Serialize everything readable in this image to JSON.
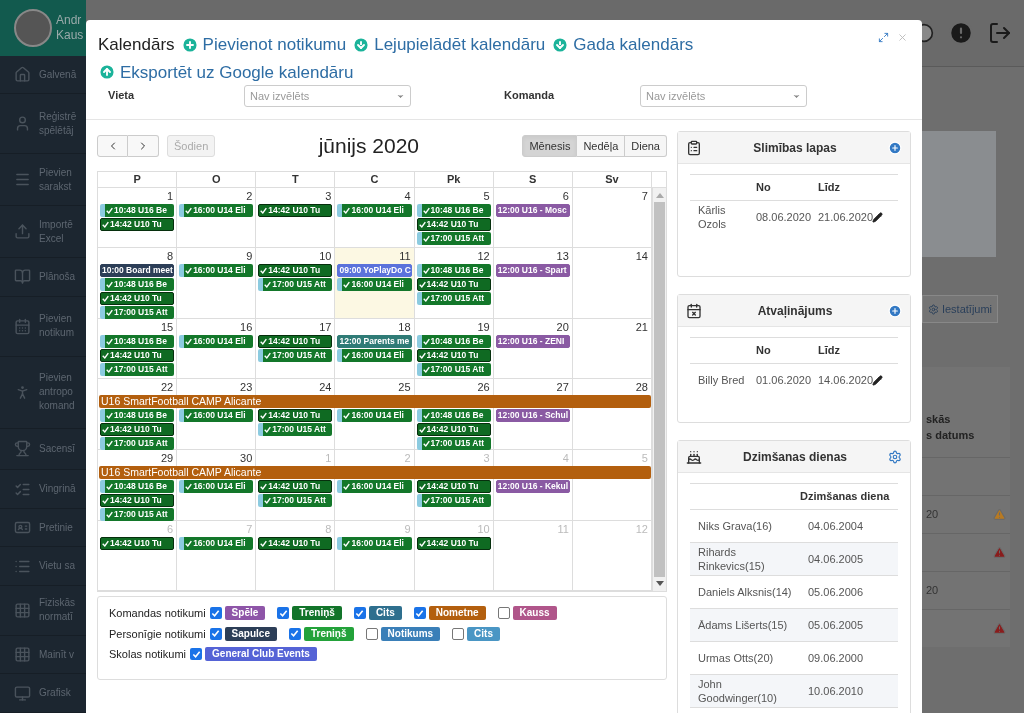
{
  "user": {
    "name_lines": [
      "Andr",
      "Kaus"
    ]
  },
  "sidebar": {
    "items": [
      {
        "lines": [
          "Galvenā"
        ]
      },
      {
        "lines": [
          "Reģistrē",
          "spēlētāj"
        ]
      },
      {
        "lines": [
          "Pievien",
          "sarakst"
        ]
      },
      {
        "lines": [
          "Importē",
          "Excel"
        ]
      },
      {
        "lines": [
          "Plānoša"
        ]
      },
      {
        "lines": [
          "Pievien",
          "notikum"
        ]
      },
      {
        "lines": [
          "Pievien",
          "antropo",
          "komand"
        ]
      },
      {
        "lines": [
          "Sacensī"
        ]
      },
      {
        "lines": [
          "Vingrinā"
        ]
      },
      {
        "lines": [
          "Pretinie"
        ]
      },
      {
        "lines": [
          "Vietu sa"
        ]
      },
      {
        "lines": [
          "Fiziskās",
          "normatī"
        ]
      },
      {
        "lines": [
          "Mainīt v"
        ]
      },
      {
        "lines": [
          "Grafisk"
        ]
      }
    ]
  },
  "background": {
    "settings_button": "Iestatījumi",
    "table_header": [
      "skās",
      "s datums"
    ],
    "rows": [
      {
        "text": "20",
        "color": "#b87a22"
      },
      {
        "color": "#8a1c1c"
      },
      {
        "text": "20"
      },
      {
        "color": "#8a1c1c"
      }
    ]
  },
  "modal": {
    "title": "Kalendārs",
    "links": [
      {
        "label": "Pievienot notikumu"
      },
      {
        "label": "Lejupielādēt kalendāru"
      },
      {
        "label": "Gada kalendārs"
      },
      {
        "label": "Eksportēt uz Google kalendāru"
      }
    ],
    "filters": [
      {
        "label": "Vieta",
        "placeholder": "Nav izvēlēts"
      },
      {
        "label": "Komanda",
        "placeholder": "Nav izvēlēts"
      }
    ]
  },
  "calendar": {
    "title": "jūnijs 2020",
    "today_button": {
      "label": "Šodien",
      "disabled": true
    },
    "views": [
      {
        "label": "Mēnesis",
        "selected": true
      },
      {
        "label": "Nedēļa",
        "selected": false
      },
      {
        "label": "Diena",
        "selected": false
      }
    ],
    "weekdays": [
      "P",
      "O",
      "T",
      "C",
      "Pk",
      "S",
      "Sv"
    ],
    "weeks": [
      {
        "days": [
          {
            "date": "1",
            "other_month": false,
            "today": false,
            "events": [
              {
                "text": "10:48 U16 Be",
                "color": "#13772a",
                "done": true,
                "stripe": true
              },
              {
                "text": "14:42 U10 Tu",
                "color": "#0f6a22",
                "done": true,
                "stripe": false
              }
            ]
          },
          {
            "date": "2",
            "other_month": false,
            "today": false,
            "events": [
              {
                "text": "16:00 U14 Eli",
                "color": "#13772a",
                "done": true,
                "stripe": true
              }
            ]
          },
          {
            "date": "3",
            "other_month": false,
            "today": false,
            "events": [
              {
                "text": "14:42 U10 Tu",
                "color": "#0f6a22",
                "done": true,
                "stripe": false
              }
            ]
          },
          {
            "date": "4",
            "other_month": false,
            "today": false,
            "events": [
              {
                "text": "16:00 U14 Eli",
                "color": "#13772a",
                "done": true,
                "stripe": true
              }
            ]
          },
          {
            "date": "5",
            "other_month": false,
            "today": false,
            "events": [
              {
                "text": "10:48 U16 Be",
                "color": "#13772a",
                "done": true,
                "stripe": true
              },
              {
                "text": "14:42 U10 Tu",
                "color": "#0f6a22",
                "done": true,
                "stripe": false
              },
              {
                "text": "17:00 U15 Att",
                "color": "#13772a",
                "done": true,
                "stripe": true
              }
            ]
          },
          {
            "date": "6",
            "other_month": false,
            "today": false,
            "events": [
              {
                "text": "12:00 U16 - Mosc",
                "color": "#8a5aa3",
                "done": false,
                "stripe": false
              }
            ]
          },
          {
            "date": "7",
            "other_month": false,
            "today": false
          }
        ]
      },
      {
        "days": [
          {
            "date": "8",
            "other_month": false,
            "today": false,
            "events": [
              {
                "text": "10:00 Board meet",
                "color": "#2c3e57",
                "done": false,
                "stripe": false
              },
              {
                "text": "10:48 U16 Be",
                "color": "#13772a",
                "done": true,
                "stripe": true
              },
              {
                "text": "14:42 U10 Tu",
                "color": "#0f6a22",
                "done": true,
                "stripe": false
              },
              {
                "text": "17:00 U15 Att",
                "color": "#13772a",
                "done": true,
                "stripe": true
              }
            ]
          },
          {
            "date": "9",
            "other_month": false,
            "today": false,
            "events": [
              {
                "text": "16:00 U14 Eli",
                "color": "#13772a",
                "done": true,
                "stripe": true
              }
            ]
          },
          {
            "date": "10",
            "other_month": false,
            "today": false,
            "events": [
              {
                "text": "14:42 U10 Tu",
                "color": "#0f6a22",
                "done": true,
                "stripe": false
              },
              {
                "text": "17:00 U15 Att",
                "color": "#13772a",
                "done": true,
                "stripe": true
              }
            ]
          },
          {
            "date": "11",
            "other_month": false,
            "today": true,
            "events": [
              {
                "text": "09:00 YoPlayDo C",
                "color": "#5b72db",
                "done": false,
                "stripe": false
              },
              {
                "text": "16:00 U14 Eli",
                "color": "#13772a",
                "done": true,
                "stripe": true
              }
            ]
          },
          {
            "date": "12",
            "other_month": false,
            "today": false,
            "events": [
              {
                "text": "10:48 U16 Be",
                "color": "#13772a",
                "done": true,
                "stripe": true
              },
              {
                "text": "14:42 U10 Tu",
                "color": "#0f6a22",
                "done": true,
                "stripe": false
              },
              {
                "text": "17:00 U15 Att",
                "color": "#13772a",
                "done": true,
                "stripe": true
              }
            ]
          },
          {
            "date": "13",
            "other_month": false,
            "today": false,
            "events": [
              {
                "text": "12:00 U16 - Spart",
                "color": "#8a5aa3",
                "done": false,
                "stripe": false
              }
            ]
          },
          {
            "date": "14",
            "other_month": false,
            "today": false
          }
        ]
      },
      {
        "days": [
          {
            "date": "15",
            "other_month": false,
            "today": false,
            "events": [
              {
                "text": "10:48 U16 Be",
                "color": "#13772a",
                "done": true,
                "stripe": true
              },
              {
                "text": "14:42 U10 Tu",
                "color": "#0f6a22",
                "done": true,
                "stripe": false
              },
              {
                "text": "17:00 U15 Att",
                "color": "#13772a",
                "done": true,
                "stripe": true
              }
            ]
          },
          {
            "date": "16",
            "other_month": false,
            "today": false,
            "events": [
              {
                "text": "16:00 U14 Eli",
                "color": "#13772a",
                "done": true,
                "stripe": true
              }
            ]
          },
          {
            "date": "17",
            "other_month": false,
            "today": false,
            "events": [
              {
                "text": "14:42 U10 Tu",
                "color": "#0f6a22",
                "done": true,
                "stripe": false
              },
              {
                "text": "17:00 U15 Att",
                "color": "#13772a",
                "done": true,
                "stripe": true
              }
            ]
          },
          {
            "date": "18",
            "other_month": false,
            "today": false,
            "events": [
              {
                "text": "12:00 Parents me",
                "color": "#2f7b76",
                "done": false,
                "stripe": false
              },
              {
                "text": "16:00 U14 Eli",
                "color": "#13772a",
                "done": true,
                "stripe": true
              }
            ]
          },
          {
            "date": "19",
            "other_month": false,
            "today": false,
            "events": [
              {
                "text": "10:48 U16 Be",
                "color": "#13772a",
                "done": true,
                "stripe": true
              },
              {
                "text": "14:42 U10 Tu",
                "color": "#0f6a22",
                "done": true,
                "stripe": false
              },
              {
                "text": "17:00 U15 Att",
                "color": "#13772a",
                "done": true,
                "stripe": true
              }
            ]
          },
          {
            "date": "20",
            "other_month": false,
            "today": false,
            "events": [
              {
                "text": "12:00 U16 - ZENI",
                "color": "#8a5aa3",
                "done": false,
                "stripe": false
              }
            ]
          },
          {
            "date": "21",
            "other_month": false,
            "today": false
          }
        ]
      },
      {
        "span": {
          "text": "U16 SmartFootball CAMP Alicante",
          "color": "#b35f0e"
        },
        "days": [
          {
            "date": "22",
            "other_month": false,
            "today": false,
            "events": [
              {
                "text": "10:48 U16 Be",
                "color": "#13772a",
                "done": true,
                "stripe": true
              },
              {
                "text": "14:42 U10 Tu",
                "color": "#0f6a22",
                "done": true,
                "stripe": false
              },
              {
                "text": "17:00 U15 Att",
                "color": "#13772a",
                "done": true,
                "stripe": true
              }
            ]
          },
          {
            "date": "23",
            "other_month": false,
            "today": false,
            "events": [
              {
                "text": "16:00 U14 Eli",
                "color": "#13772a",
                "done": true,
                "stripe": true
              }
            ]
          },
          {
            "date": "24",
            "other_month": false,
            "today": false,
            "events": [
              {
                "text": "14:42 U10 Tu",
                "color": "#0f6a22",
                "done": true,
                "stripe": false
              },
              {
                "text": "17:00 U15 Att",
                "color": "#13772a",
                "done": true,
                "stripe": true
              }
            ]
          },
          {
            "date": "25",
            "other_month": false,
            "today": false,
            "events": [
              {
                "text": "16:00 U14 Eli",
                "color": "#13772a",
                "done": true,
                "stripe": true
              }
            ]
          },
          {
            "date": "26",
            "other_month": false,
            "today": false,
            "events": [
              {
                "text": "10:48 U16 Be",
                "color": "#13772a",
                "done": true,
                "stripe": true
              },
              {
                "text": "14:42 U10 Tu",
                "color": "#0f6a22",
                "done": true,
                "stripe": false
              },
              {
                "text": "17:00 U15 Att",
                "color": "#13772a",
                "done": true,
                "stripe": true
              }
            ]
          },
          {
            "date": "27",
            "other_month": false,
            "today": false,
            "events": [
              {
                "text": "12:00 U16 - Schul",
                "color": "#8a5aa3",
                "done": false,
                "stripe": false
              }
            ]
          },
          {
            "date": "28",
            "other_month": false,
            "today": false
          }
        ]
      },
      {
        "span": {
          "text": "U16 SmartFootball CAMP Alicante",
          "color": "#b35f0e"
        },
        "days": [
          {
            "date": "29",
            "other_month": false,
            "today": false,
            "events": [
              {
                "text": "10:48 U16 Be",
                "color": "#13772a",
                "done": true,
                "stripe": true
              },
              {
                "text": "14:42 U10 Tu",
                "color": "#0f6a22",
                "done": true,
                "stripe": false
              },
              {
                "text": "17:00 U15 Att",
                "color": "#13772a",
                "done": true,
                "stripe": true
              }
            ]
          },
          {
            "date": "30",
            "other_month": false,
            "today": false,
            "events": [
              {
                "text": "16:00 U14 Eli",
                "color": "#13772a",
                "done": true,
                "stripe": true
              }
            ]
          },
          {
            "date": "1",
            "other_month": true,
            "today": false,
            "events": [
              {
                "text": "14:42 U10 Tu",
                "color": "#0f6a22",
                "done": true,
                "stripe": false
              },
              {
                "text": "17:00 U15 Att",
                "color": "#13772a",
                "done": true,
                "stripe": true
              }
            ]
          },
          {
            "date": "2",
            "other_month": true,
            "today": false,
            "events": [
              {
                "text": "16:00 U14 Eli",
                "color": "#13772a",
                "done": true,
                "stripe": true
              }
            ]
          },
          {
            "date": "3",
            "other_month": true,
            "today": false,
            "events": [
              {
                "text": "14:42 U10 Tu",
                "color": "#0f6a22",
                "done": true,
                "stripe": false
              },
              {
                "text": "17:00 U15 Att",
                "color": "#13772a",
                "done": true,
                "stripe": true
              }
            ]
          },
          {
            "date": "4",
            "other_month": true,
            "today": false,
            "events": [
              {
                "text": "12:00 U16 - Kekul",
                "color": "#8a5aa3",
                "done": false,
                "stripe": false
              }
            ]
          },
          {
            "date": "5",
            "other_month": true,
            "today": false
          }
        ]
      },
      {
        "days": [
          {
            "date": "6",
            "other_month": true,
            "today": false,
            "events": [
              {
                "text": "14:42 U10 Tu",
                "color": "#0f6a22",
                "done": true,
                "stripe": false
              }
            ]
          },
          {
            "date": "7",
            "other_month": true,
            "today": false,
            "events": [
              {
                "text": "16:00 U14 Eli",
                "color": "#13772a",
                "done": true,
                "stripe": true
              }
            ]
          },
          {
            "date": "8",
            "other_month": true,
            "today": false,
            "events": [
              {
                "text": "14:42 U10 Tu",
                "color": "#0f6a22",
                "done": true,
                "stripe": false
              }
            ]
          },
          {
            "date": "9",
            "other_month": true,
            "today": false,
            "events": [
              {
                "text": "16:00 U14 Eli",
                "color": "#13772a",
                "done": true,
                "stripe": true
              }
            ]
          },
          {
            "date": "10",
            "other_month": true,
            "today": false,
            "events": [
              {
                "text": "14:42 U10 Tu",
                "color": "#0f6a22",
                "done": true,
                "stripe": false
              }
            ]
          },
          {
            "date": "11",
            "other_month": true,
            "today": false
          },
          {
            "date": "12",
            "other_month": true,
            "today": false
          }
        ]
      }
    ]
  },
  "legend": [
    {
      "label": "Komandas notikumi",
      "items": [
        {
          "label": "Spēle",
          "checked": true,
          "color": "#8e55a8"
        },
        {
          "label": "Treniņš",
          "checked": true,
          "color": "#12742a"
        },
        {
          "label": "Cits",
          "checked": true,
          "color": "#2e6f8e"
        },
        {
          "label": "Nometne",
          "checked": true,
          "color": "#b35f0e"
        },
        {
          "label": "Kauss",
          "checked": false,
          "color": "#b0558a"
        }
      ]
    },
    {
      "label": "Personīgie notikumi",
      "items": [
        {
          "label": "Sapulce",
          "checked": true,
          "color": "#2c3e57"
        },
        {
          "label": "Treniņš",
          "checked": true,
          "color": "#23a23a"
        },
        {
          "label": "Notikums",
          "checked": false,
          "color": "#3a7fb8"
        },
        {
          "label": "Cits",
          "checked": false,
          "color": "#4a96c4"
        }
      ]
    },
    {
      "label": "Skolas notikumi",
      "items": [
        {
          "label": "General Club Events",
          "checked": true,
          "color": "#5563d6"
        }
      ]
    }
  ],
  "panels": [
    {
      "title": "Slimības lapas",
      "columns": [
        "",
        "No",
        "Līdz"
      ],
      "rows": [
        {
          "cells": [
            "Kārlis Ozols",
            "08.06.2020",
            "21.06.2020"
          ],
          "editable": true
        }
      ]
    },
    {
      "title": "Atvaļinājums",
      "columns": [
        "",
        "No",
        "Līdz"
      ],
      "rows": [
        {
          "cells": [
            "Billy Bred",
            "01.06.2020",
            "14.06.2020"
          ],
          "editable": true
        }
      ]
    },
    {
      "title": "Dzimšanas dienas",
      "columns": [
        "",
        "Dzimšanas diena"
      ],
      "rows": [
        {
          "cells": [
            "Niks Grava(16)",
            "04.06.2004"
          ]
        },
        {
          "cells": [
            "Rihards Rinkevics(15)",
            "04.06.2005"
          ]
        },
        {
          "cells": [
            "Daniels Alksnis(14)",
            "05.06.2006"
          ]
        },
        {
          "cells": [
            "Ādams Lišerts(15)",
            "05.06.2005"
          ]
        },
        {
          "cells": [
            "Urmas Otts(20)",
            "09.06.2000"
          ]
        },
        {
          "cells": [
            "John Goodwinger(10)",
            "10.06.2010"
          ]
        }
      ]
    }
  ]
}
